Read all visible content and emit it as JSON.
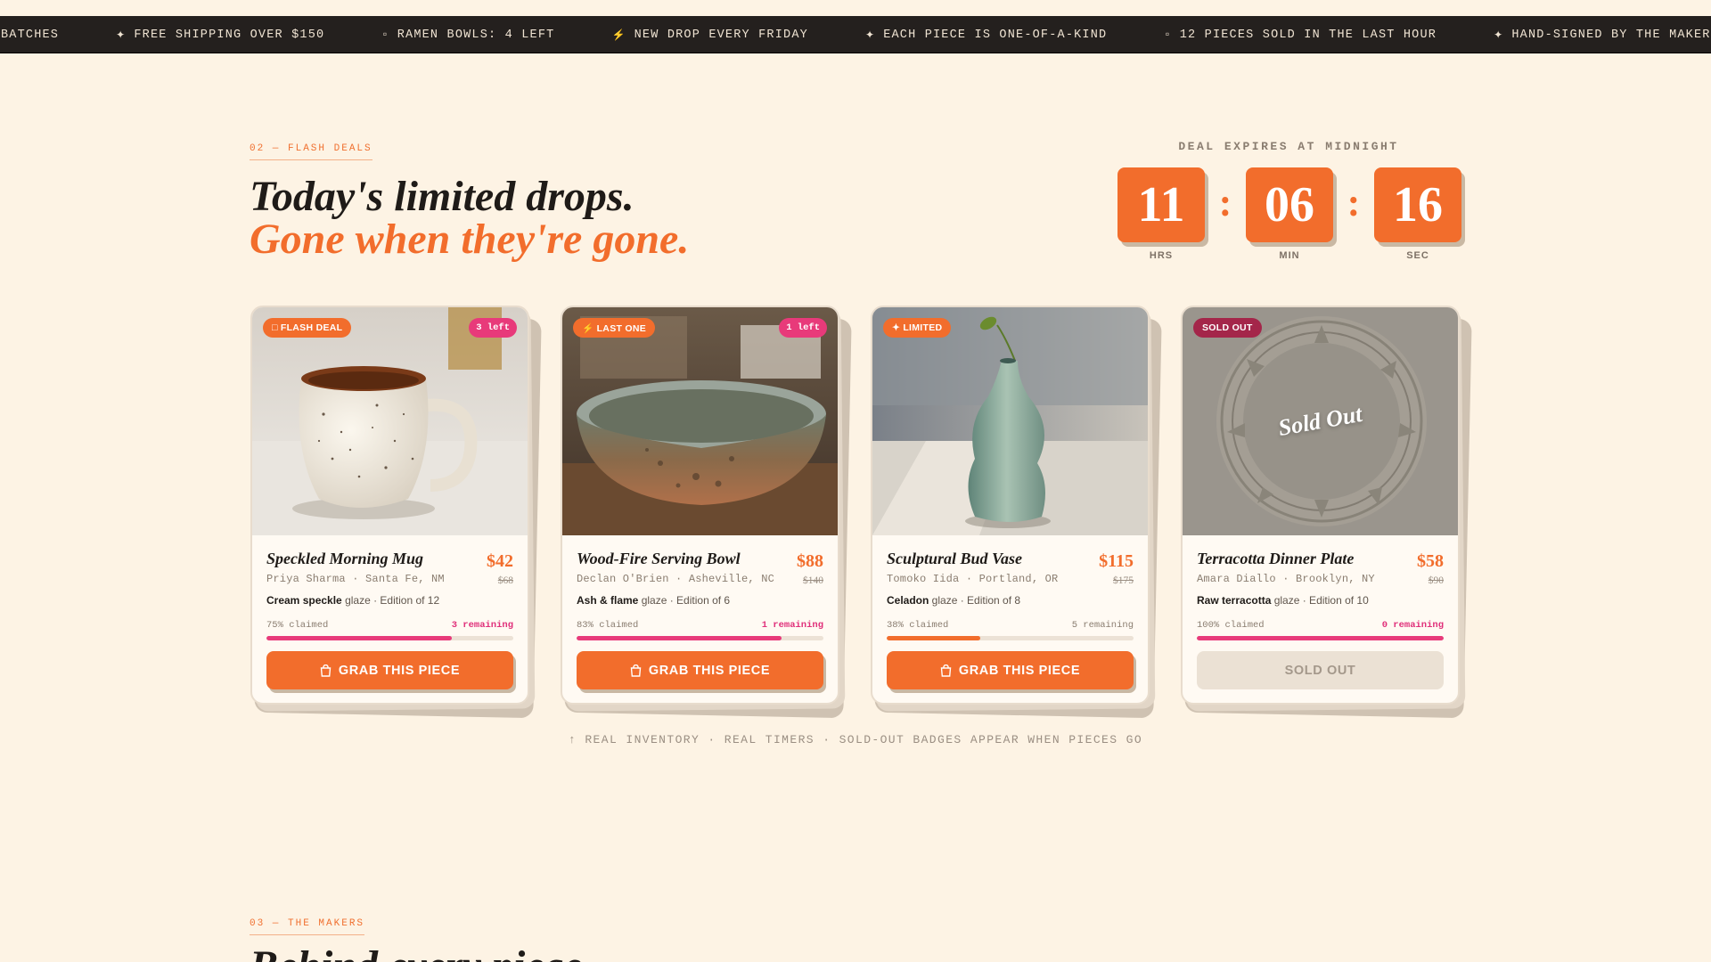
{
  "ticker": [
    {
      "glyph": "",
      "text": "BATCHES"
    },
    {
      "glyph": "✦",
      "text": "FREE SHIPPING OVER $150"
    },
    {
      "glyph": "▫",
      "text": "RAMEN BOWLS: 4 LEFT"
    },
    {
      "glyph": "⚡",
      "text": "NEW DROP EVERY FRIDAY"
    },
    {
      "glyph": "✦",
      "text": "EACH PIECE IS ONE-OF-A-KIND"
    },
    {
      "glyph": "▫",
      "text": "12 PIECES SOLD IN THE LAST HOUR"
    },
    {
      "glyph": "✦",
      "text": "HAND-SIGNED BY THE MAKER"
    }
  ],
  "flash": {
    "label": "02 — FLASH DEALS",
    "headline_line1": "Today's limited drops.",
    "headline_line2": "Gone when they're gone.",
    "timer_caption": "DEAL EXPIRES AT MIDNIGHT",
    "timer": {
      "hours": "11",
      "hours_label": "HRS",
      "minutes": "06",
      "minutes_label": "MIN",
      "seconds": "16",
      "seconds_label": "SEC",
      "separator": ":"
    }
  },
  "products": [
    {
      "badge": "□ FLASH DEAL",
      "left_badge": "3 left",
      "title": "Speckled Morning Mug",
      "maker": "Priya Sharma · Santa Fe, NM",
      "price": "$42",
      "was": "$68",
      "glaze_name": "Cream speckle",
      "glaze_rest": " glaze · Edition of 12",
      "claimed": "75% claimed",
      "claimed_fraction": 0.75,
      "remaining": "3 remaining",
      "cta": "GRAB THIS PIECE"
    },
    {
      "badge": "⚡ LAST ONE",
      "left_badge": "1 left",
      "title": "Wood-Fire Serving Bowl",
      "maker": "Declan O'Brien · Asheville, NC",
      "price": "$88",
      "was": "$140",
      "glaze_name": "Ash & flame",
      "glaze_rest": " glaze · Edition of 6",
      "claimed": "83% claimed",
      "claimed_fraction": 0.83,
      "remaining": "1 remaining",
      "cta": "GRAB THIS PIECE"
    },
    {
      "badge": "✦ LIMITED",
      "title": "Sculptural Bud Vase",
      "maker": "Tomoko Iida · Portland, OR",
      "price": "$115",
      "was": "$175",
      "glaze_name": "Celadon",
      "glaze_rest": " glaze · Edition of 8",
      "claimed": "38% claimed",
      "claimed_fraction": 0.38,
      "remaining": "5 remaining",
      "cta": "GRAB THIS PIECE"
    },
    {
      "badge": "SOLD OUT",
      "overlay": "Sold Out",
      "title": "Terracotta Dinner Plate",
      "maker": "Amara Diallo · Brooklyn, NY",
      "price": "$58",
      "was": "$90",
      "glaze_name": "Raw terracotta",
      "glaze_rest": " glaze · Edition of 10",
      "claimed": "100% claimed",
      "claimed_fraction": 1.0,
      "remaining": "0 remaining",
      "cta": "SOLD OUT"
    }
  ],
  "footnote": "↑ REAL INVENTORY · REAL TIMERS · SOLD-OUT BADGES APPEAR WHEN PIECES GO",
  "makers": {
    "label": "03 — THE MAKERS",
    "heading": "Behind every piece"
  },
  "colors": {
    "background": "#fdf3e4",
    "accent": "#f26d2c",
    "pink": "#e83a7a",
    "ticker_bg": "#24201e"
  }
}
